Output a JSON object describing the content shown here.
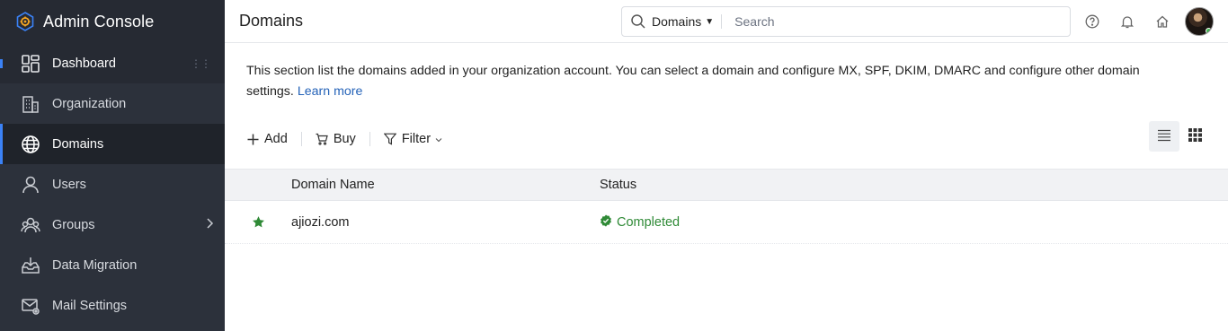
{
  "app": {
    "title": "Admin Console"
  },
  "sidebar": {
    "items": [
      {
        "label": "Dashboard",
        "icon": "dashboard-icon"
      },
      {
        "label": "Organization",
        "icon": "building-icon"
      },
      {
        "label": "Domains",
        "icon": "globe-icon",
        "active": true
      },
      {
        "label": "Users",
        "icon": "user-icon"
      },
      {
        "label": "Groups",
        "icon": "group-icon"
      },
      {
        "label": "Data Migration",
        "icon": "inbox-download-icon"
      },
      {
        "label": "Mail Settings",
        "icon": "mail-settings-icon"
      }
    ]
  },
  "header": {
    "page_title": "Domains",
    "search": {
      "scope": "Domains",
      "placeholder": "Search"
    },
    "icons": [
      "help-icon",
      "bell-icon",
      "home-icon",
      "avatar"
    ]
  },
  "main": {
    "description": "This section list the domains added in your organization account. You can select a domain and configure MX, SPF, DKIM, DMARC and configure other domain settings.",
    "learn_more": "Learn more",
    "toolbar": {
      "add_label": "Add",
      "buy_label": "Buy",
      "filter_label": "Filter"
    },
    "table": {
      "columns": [
        "Domain Name",
        "Status"
      ],
      "rows": [
        {
          "starred": true,
          "domain": "ajiozi.com",
          "status": "Completed"
        }
      ]
    }
  },
  "colors": {
    "sidebar_bg": "#2c313b",
    "accent": "#3b82f6",
    "status_completed": "#2f8a36",
    "link": "#2563b8"
  }
}
